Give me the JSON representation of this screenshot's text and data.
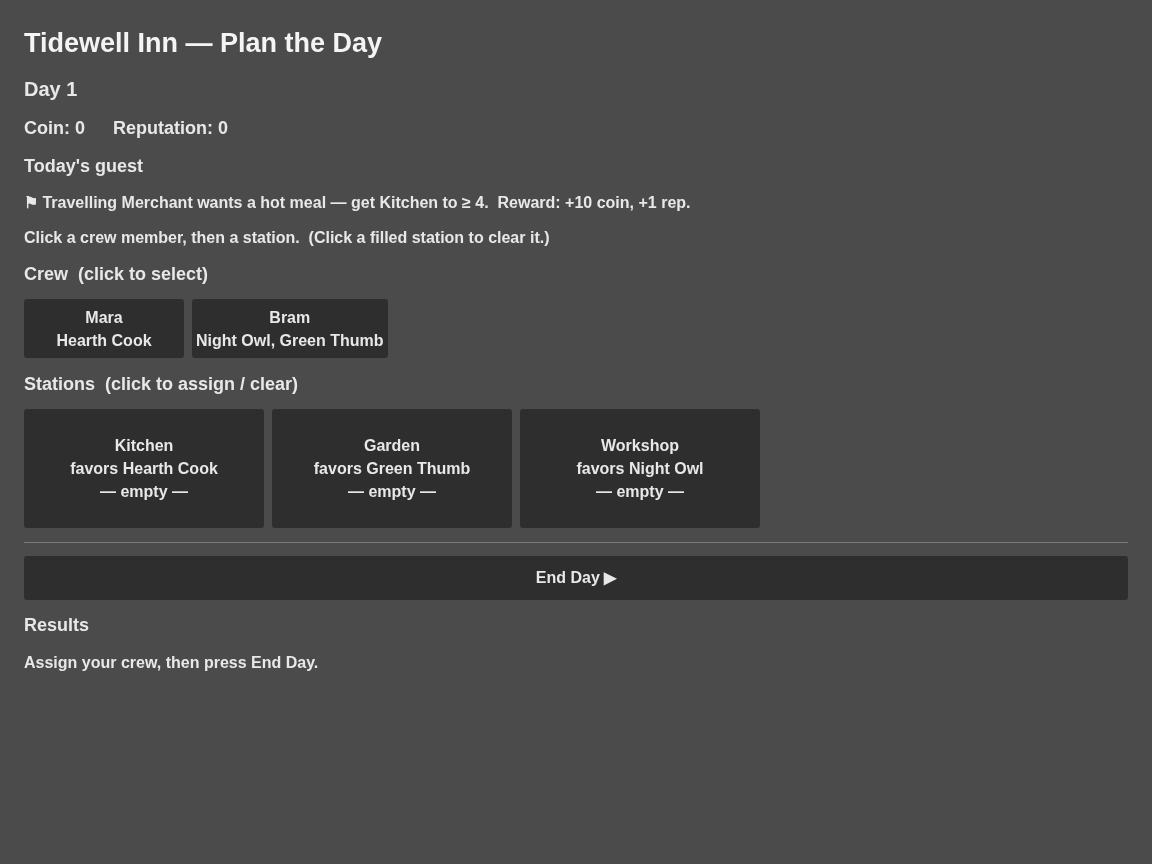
{
  "title": "Tidewell Inn — Plan the Day",
  "day": "Day 1",
  "stats": [
    "Coin: 0",
    "Reputation: 0"
  ],
  "guest": {
    "heading": "Today's guest",
    "request": "⚑ Travelling Merchant wants a hot meal — get Kitchen to ≥ 4.  Reward: +10 coin, +1 rep."
  },
  "instructions": "Click a crew member, then a station.  (Click a filled station to clear it.)",
  "crew": {
    "heading": "Crew  (click to select)",
    "members": [
      {
        "name": "Mara",
        "traits": "Hearth Cook",
        "selected": false
      },
      {
        "name": "Bram",
        "traits": "Night Owl, Green Thumb",
        "selected": false
      }
    ]
  },
  "stations": {
    "heading": "Stations  (click to assign / clear)",
    "items": [
      {
        "name": "Kitchen",
        "favors": "favors Hearth Cook",
        "assigned": "— empty —"
      },
      {
        "name": "Garden",
        "favors": "favors Green Thumb",
        "assigned": "— empty —"
      },
      {
        "name": "Workshop",
        "favors": "favors Night Owl",
        "assigned": "— empty —"
      }
    ]
  },
  "end_day_button": "End Day ▶",
  "results": {
    "heading": "Results",
    "message": "Assign your crew, then press End Day."
  }
}
